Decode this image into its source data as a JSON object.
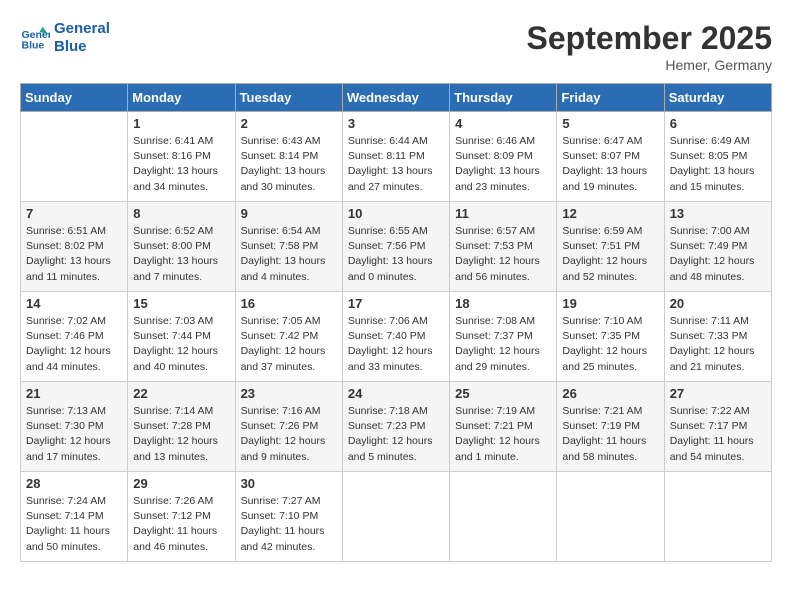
{
  "header": {
    "logo_line1": "General",
    "logo_line2": "Blue",
    "month": "September 2025",
    "location": "Hemer, Germany"
  },
  "days_of_week": [
    "Sunday",
    "Monday",
    "Tuesday",
    "Wednesday",
    "Thursday",
    "Friday",
    "Saturday"
  ],
  "weeks": [
    [
      {
        "day": "",
        "info": ""
      },
      {
        "day": "1",
        "info": "Sunrise: 6:41 AM\nSunset: 8:16 PM\nDaylight: 13 hours\nand 34 minutes."
      },
      {
        "day": "2",
        "info": "Sunrise: 6:43 AM\nSunset: 8:14 PM\nDaylight: 13 hours\nand 30 minutes."
      },
      {
        "day": "3",
        "info": "Sunrise: 6:44 AM\nSunset: 8:11 PM\nDaylight: 13 hours\nand 27 minutes."
      },
      {
        "day": "4",
        "info": "Sunrise: 6:46 AM\nSunset: 8:09 PM\nDaylight: 13 hours\nand 23 minutes."
      },
      {
        "day": "5",
        "info": "Sunrise: 6:47 AM\nSunset: 8:07 PM\nDaylight: 13 hours\nand 19 minutes."
      },
      {
        "day": "6",
        "info": "Sunrise: 6:49 AM\nSunset: 8:05 PM\nDaylight: 13 hours\nand 15 minutes."
      }
    ],
    [
      {
        "day": "7",
        "info": "Sunrise: 6:51 AM\nSunset: 8:02 PM\nDaylight: 13 hours\nand 11 minutes."
      },
      {
        "day": "8",
        "info": "Sunrise: 6:52 AM\nSunset: 8:00 PM\nDaylight: 13 hours\nand 7 minutes."
      },
      {
        "day": "9",
        "info": "Sunrise: 6:54 AM\nSunset: 7:58 PM\nDaylight: 13 hours\nand 4 minutes."
      },
      {
        "day": "10",
        "info": "Sunrise: 6:55 AM\nSunset: 7:56 PM\nDaylight: 13 hours\nand 0 minutes."
      },
      {
        "day": "11",
        "info": "Sunrise: 6:57 AM\nSunset: 7:53 PM\nDaylight: 12 hours\nand 56 minutes."
      },
      {
        "day": "12",
        "info": "Sunrise: 6:59 AM\nSunset: 7:51 PM\nDaylight: 12 hours\nand 52 minutes."
      },
      {
        "day": "13",
        "info": "Sunrise: 7:00 AM\nSunset: 7:49 PM\nDaylight: 12 hours\nand 48 minutes."
      }
    ],
    [
      {
        "day": "14",
        "info": "Sunrise: 7:02 AM\nSunset: 7:46 PM\nDaylight: 12 hours\nand 44 minutes."
      },
      {
        "day": "15",
        "info": "Sunrise: 7:03 AM\nSunset: 7:44 PM\nDaylight: 12 hours\nand 40 minutes."
      },
      {
        "day": "16",
        "info": "Sunrise: 7:05 AM\nSunset: 7:42 PM\nDaylight: 12 hours\nand 37 minutes."
      },
      {
        "day": "17",
        "info": "Sunrise: 7:06 AM\nSunset: 7:40 PM\nDaylight: 12 hours\nand 33 minutes."
      },
      {
        "day": "18",
        "info": "Sunrise: 7:08 AM\nSunset: 7:37 PM\nDaylight: 12 hours\nand 29 minutes."
      },
      {
        "day": "19",
        "info": "Sunrise: 7:10 AM\nSunset: 7:35 PM\nDaylight: 12 hours\nand 25 minutes."
      },
      {
        "day": "20",
        "info": "Sunrise: 7:11 AM\nSunset: 7:33 PM\nDaylight: 12 hours\nand 21 minutes."
      }
    ],
    [
      {
        "day": "21",
        "info": "Sunrise: 7:13 AM\nSunset: 7:30 PM\nDaylight: 12 hours\nand 17 minutes."
      },
      {
        "day": "22",
        "info": "Sunrise: 7:14 AM\nSunset: 7:28 PM\nDaylight: 12 hours\nand 13 minutes."
      },
      {
        "day": "23",
        "info": "Sunrise: 7:16 AM\nSunset: 7:26 PM\nDaylight: 12 hours\nand 9 minutes."
      },
      {
        "day": "24",
        "info": "Sunrise: 7:18 AM\nSunset: 7:23 PM\nDaylight: 12 hours\nand 5 minutes."
      },
      {
        "day": "25",
        "info": "Sunrise: 7:19 AM\nSunset: 7:21 PM\nDaylight: 12 hours\nand 1 minute."
      },
      {
        "day": "26",
        "info": "Sunrise: 7:21 AM\nSunset: 7:19 PM\nDaylight: 11 hours\nand 58 minutes."
      },
      {
        "day": "27",
        "info": "Sunrise: 7:22 AM\nSunset: 7:17 PM\nDaylight: 11 hours\nand 54 minutes."
      }
    ],
    [
      {
        "day": "28",
        "info": "Sunrise: 7:24 AM\nSunset: 7:14 PM\nDaylight: 11 hours\nand 50 minutes."
      },
      {
        "day": "29",
        "info": "Sunrise: 7:26 AM\nSunset: 7:12 PM\nDaylight: 11 hours\nand 46 minutes."
      },
      {
        "day": "30",
        "info": "Sunrise: 7:27 AM\nSunset: 7:10 PM\nDaylight: 11 hours\nand 42 minutes."
      },
      {
        "day": "",
        "info": ""
      },
      {
        "day": "",
        "info": ""
      },
      {
        "day": "",
        "info": ""
      },
      {
        "day": "",
        "info": ""
      }
    ]
  ]
}
